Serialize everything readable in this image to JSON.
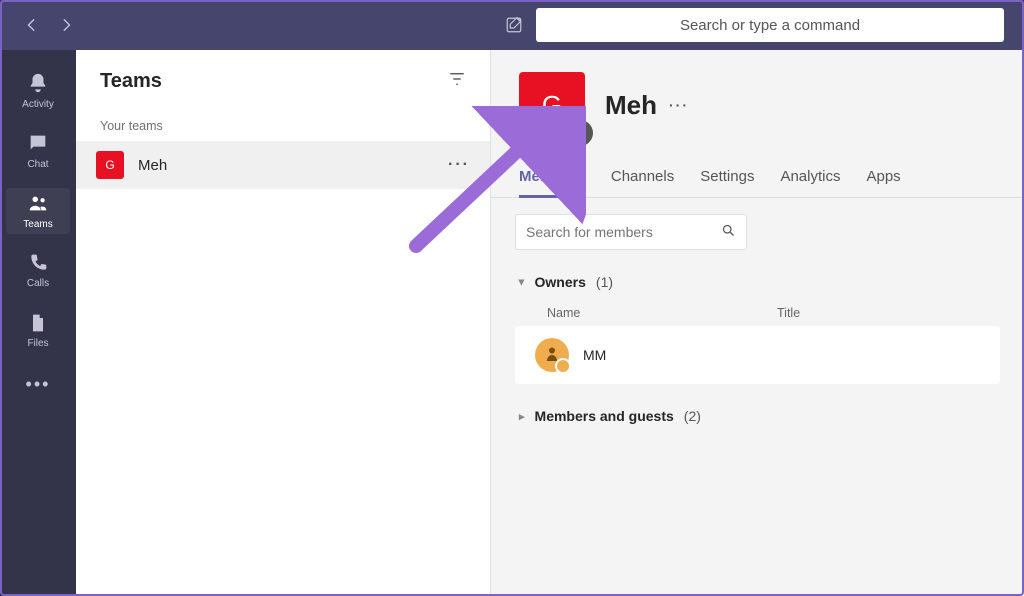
{
  "titlebar": {
    "search_placeholder": "Search or type a command"
  },
  "apprail": {
    "items": [
      {
        "id": "activity",
        "label": "Activity"
      },
      {
        "id": "chat",
        "label": "Chat"
      },
      {
        "id": "teams",
        "label": "Teams"
      },
      {
        "id": "calls",
        "label": "Calls"
      },
      {
        "id": "files",
        "label": "Files"
      }
    ],
    "active": "teams"
  },
  "teamlist": {
    "title": "Teams",
    "section_label": "Your teams",
    "items": [
      {
        "initial": "G",
        "name": "Meh"
      }
    ]
  },
  "main": {
    "team_initial": "G",
    "team_name": "Meh",
    "tabs": [
      "Members",
      "Channels",
      "Settings",
      "Analytics",
      "Apps"
    ],
    "active_tab": "Members",
    "member_search_placeholder": "Search for members",
    "columns": {
      "name": "Name",
      "title": "Title"
    },
    "groups": [
      {
        "label": "Owners",
        "count": 1,
        "open": true,
        "members": [
          {
            "display": "MM"
          }
        ]
      },
      {
        "label": "Members and guests",
        "count": 2,
        "open": false,
        "members": []
      }
    ]
  },
  "colors": {
    "accent": "#6264a7",
    "brand_red": "#e81123",
    "rail_bg": "#33344a",
    "titlebar_bg": "#45456e",
    "annotation": "#9b6bd8"
  }
}
